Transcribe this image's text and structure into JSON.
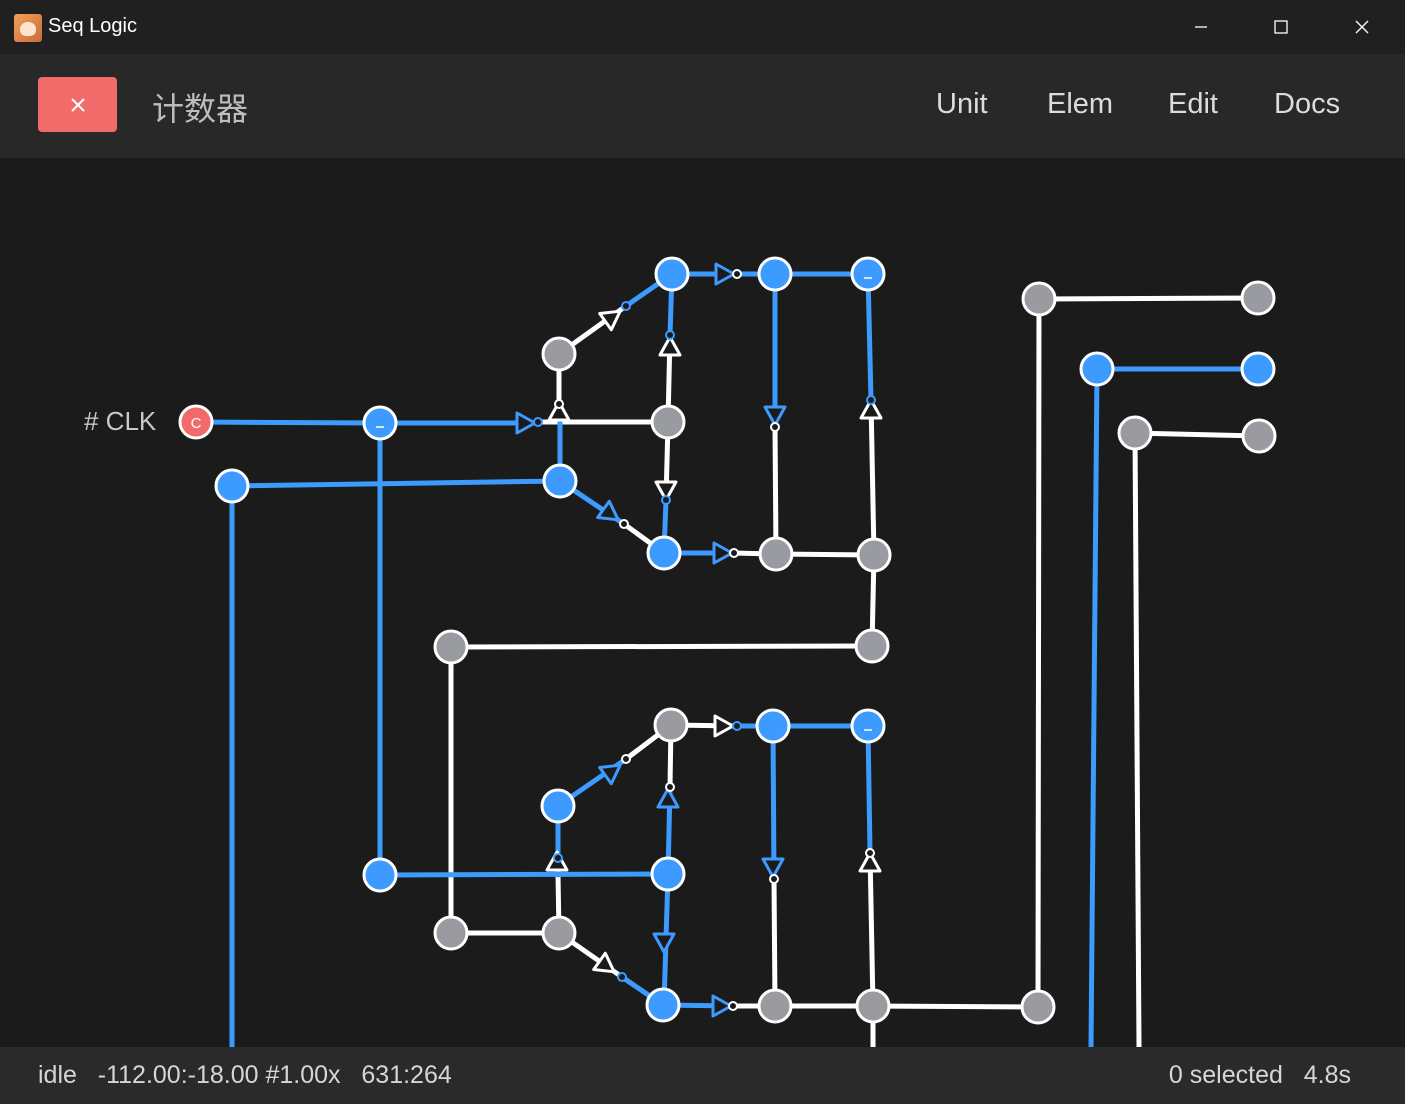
{
  "window": {
    "title": "Seq Logic",
    "minimize_icon": "minimize-icon",
    "maximize_icon": "maximize-icon",
    "close_icon": "close-icon"
  },
  "header": {
    "close_button_icon": "close-icon",
    "title": "计数器",
    "menu": [
      "Unit",
      "Elem",
      "Edit",
      "Docs"
    ]
  },
  "canvas": {
    "input_label": "# CLK",
    "clock_node_label": "C",
    "colors": {
      "background": "#1b1b1b",
      "active": "#3d9bff",
      "inactive": "#9a9ba0",
      "wire_inactive": "#ffffff",
      "clock": "#f26b6b"
    }
  },
  "status": {
    "state": "idle",
    "view": "-112.00:-18.00 #1.00x",
    "cursor": "631:264",
    "selection": "0 selected",
    "time": "4.8s"
  }
}
